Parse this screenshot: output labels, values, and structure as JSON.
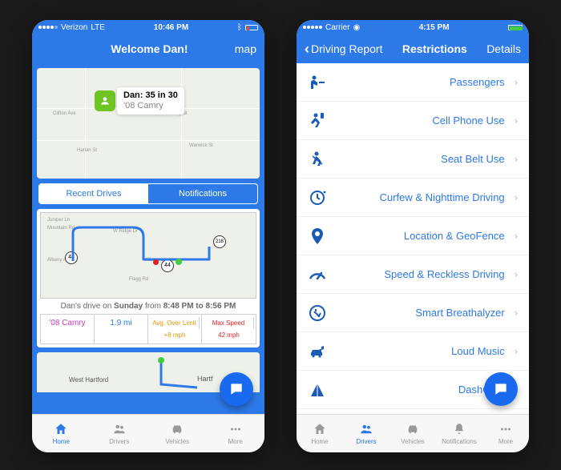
{
  "left": {
    "status": {
      "carrier": "Verizon",
      "network": "LTE",
      "time": "10:46 PM"
    },
    "nav": {
      "title": "Welcome Dan!",
      "right": "map"
    },
    "pin": {
      "line1": "Dan: 35 in 30",
      "line2": "'08 Camry"
    },
    "segments": {
      "a": "Recent Drives",
      "b": "Notifications"
    },
    "drive": {
      "summary_prefix": "Dan's drive on ",
      "summary_day": "Sunday",
      "summary_middle": " from ",
      "summary_time": "8:48 PM to 8:56 PM",
      "car": "'08 Camry",
      "dist": "1.9 mi",
      "avg_label": "Avg. Over Limit",
      "avg_val": "+8 mph",
      "max_label": "Max Speed",
      "max_val": "42 mph"
    },
    "peek_place1": "West Hartford",
    "peek_place2": "Hartf",
    "tabs": {
      "home": "Home",
      "drivers": "Drivers",
      "vehicles": "Vehicles",
      "more": "More"
    }
  },
  "right": {
    "status": {
      "carrier": "Carrier",
      "time": "4:15 PM"
    },
    "nav": {
      "back": "Driving Report",
      "title": "Restrictions",
      "right": "Details"
    },
    "items": [
      "Passengers",
      "Cell Phone Use",
      "Seat Belt Use",
      "Curfew & Nighttime Driving",
      "Location & GeoFence",
      "Speed & Reckless Driving",
      "Smart Breathalyzer",
      "Loud Music",
      "DashCam"
    ],
    "tabs": {
      "home": "Home",
      "drivers": "Drivers",
      "vehicles": "Vehicles",
      "notifications": "Notifications",
      "more": "More"
    }
  }
}
